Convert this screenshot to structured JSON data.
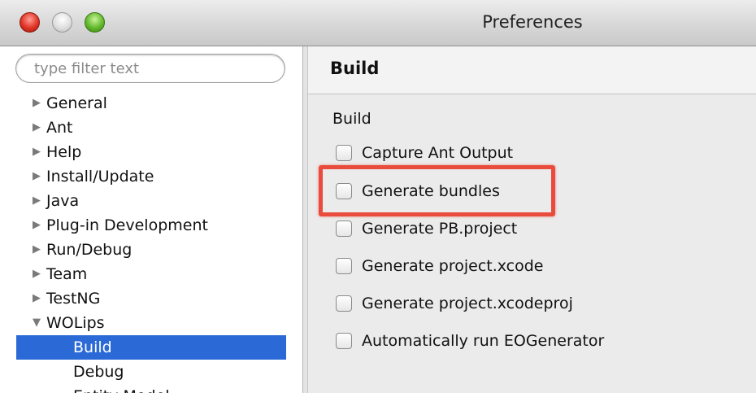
{
  "window": {
    "title": "Preferences"
  },
  "filter": {
    "placeholder": "type filter text"
  },
  "tree": {
    "items": [
      {
        "label": "General",
        "arrow": "▶"
      },
      {
        "label": "Ant",
        "arrow": "▶"
      },
      {
        "label": "Help",
        "arrow": "▶"
      },
      {
        "label": "Install/Update",
        "arrow": "▶"
      },
      {
        "label": "Java",
        "arrow": "▶"
      },
      {
        "label": "Plug-in Development",
        "arrow": "▶"
      },
      {
        "label": "Run/Debug",
        "arrow": "▶"
      },
      {
        "label": "Team",
        "arrow": "▶"
      },
      {
        "label": "TestNG",
        "arrow": "▶"
      },
      {
        "label": "WOLips",
        "arrow": "▼"
      }
    ],
    "children": [
      {
        "label": "Build",
        "selected": true
      },
      {
        "label": "Debug",
        "selected": false
      },
      {
        "label": "Entity Model",
        "selected": false
      }
    ]
  },
  "page": {
    "title": "Build",
    "group_label": "Build",
    "options": [
      {
        "label": "Capture Ant Output",
        "checked": false
      },
      {
        "label": "Generate bundles",
        "checked": false,
        "highlighted": true
      },
      {
        "label": "Generate PB.project",
        "checked": false
      },
      {
        "label": "Generate project.xcode",
        "checked": false
      },
      {
        "label": "Generate project.xcodeproj",
        "checked": false
      },
      {
        "label": "Automatically run EOGenerator",
        "checked": false
      }
    ]
  },
  "colors": {
    "selection": "#2b6ad6",
    "highlight_box": "#e94b3c"
  }
}
